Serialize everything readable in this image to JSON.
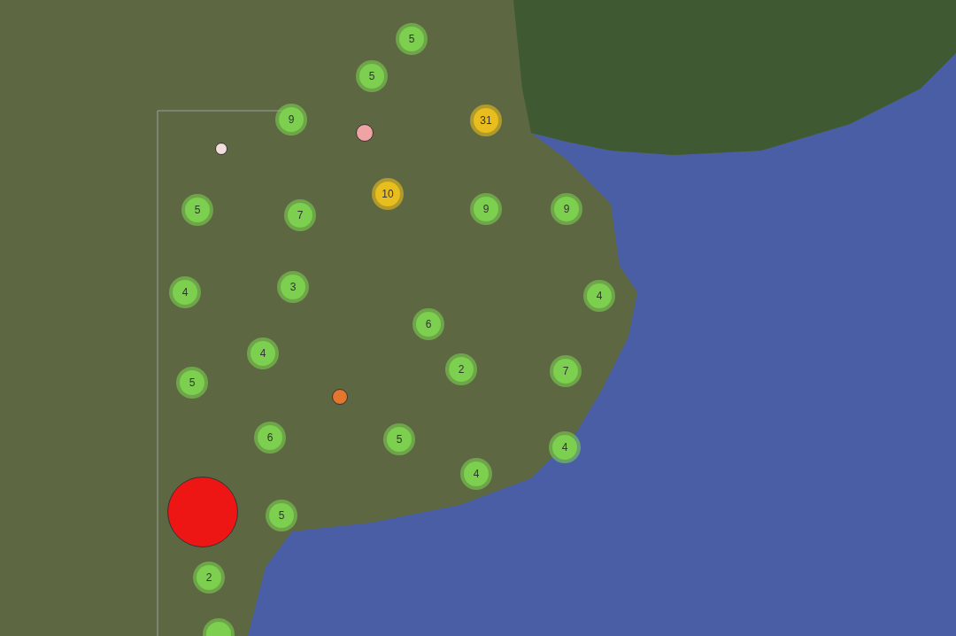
{
  "map": {
    "markers": [
      {
        "kind": "cluster",
        "count": "5",
        "color": "#7ccf4f"
      },
      {
        "kind": "cluster",
        "count": "5",
        "color": "#7ccf4f"
      },
      {
        "kind": "cluster",
        "count": "9",
        "color": "#7ccf4f"
      },
      {
        "kind": "cluster",
        "count": "31",
        "color": "#e8bd1e"
      },
      {
        "kind": "cluster",
        "count": "10",
        "color": "#e8bd1e"
      },
      {
        "kind": "cluster",
        "count": "5",
        "color": "#7ccf4f"
      },
      {
        "kind": "cluster",
        "count": "7",
        "color": "#7ccf4f"
      },
      {
        "kind": "cluster",
        "count": "9",
        "color": "#7ccf4f"
      },
      {
        "kind": "cluster",
        "count": "9",
        "color": "#7ccf4f"
      },
      {
        "kind": "cluster",
        "count": "4",
        "color": "#7ccf4f"
      },
      {
        "kind": "cluster",
        "count": "3",
        "color": "#7ccf4f"
      },
      {
        "kind": "cluster",
        "count": "4",
        "color": "#7ccf4f"
      },
      {
        "kind": "cluster",
        "count": "6",
        "color": "#7ccf4f"
      },
      {
        "kind": "cluster",
        "count": "4",
        "color": "#7ccf4f"
      },
      {
        "kind": "cluster",
        "count": "2",
        "color": "#7ccf4f"
      },
      {
        "kind": "cluster",
        "count": "7",
        "color": "#7ccf4f"
      },
      {
        "kind": "cluster",
        "count": "5",
        "color": "#7ccf4f"
      },
      {
        "kind": "cluster",
        "count": "6",
        "color": "#7ccf4f"
      },
      {
        "kind": "cluster",
        "count": "5",
        "color": "#7ccf4f"
      },
      {
        "kind": "cluster",
        "count": "4",
        "color": "#7ccf4f"
      },
      {
        "kind": "cluster",
        "count": "4",
        "color": "#7ccf4f"
      },
      {
        "kind": "cluster",
        "count": "5",
        "color": "#7ccf4f"
      },
      {
        "kind": "cluster",
        "count": "2",
        "color": "#7ccf4f"
      },
      {
        "kind": "cluster",
        "color": "#7ccf4f"
      },
      {
        "kind": "point",
        "color": "#f0a3a3"
      },
      {
        "kind": "point",
        "color": "#f3dede"
      },
      {
        "kind": "point",
        "color": "#e5762e"
      },
      {
        "kind": "point",
        "color": "#ee1515"
      }
    ]
  }
}
